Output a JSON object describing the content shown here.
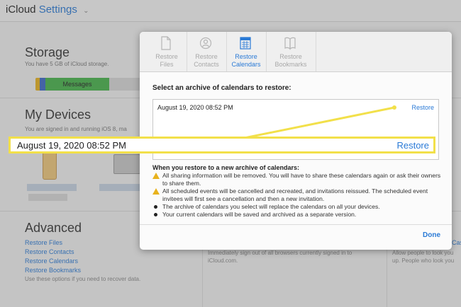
{
  "header": {
    "brand_a": "iCloud",
    "brand_b": "Settings",
    "chevron": "⌄"
  },
  "storage": {
    "title": "Storage",
    "subtitle": "You have 5 GB of iCloud storage.",
    "bar_label": "Messages"
  },
  "devices": {
    "title": "My Devices",
    "subtitle": "You are signed in and running iOS 8, ma"
  },
  "advanced": {
    "title": "Advanced",
    "links": [
      "Restore Files",
      "Restore Contacts",
      "Restore Calendars",
      "Restore Bookmarks"
    ],
    "note": "Use these options if you need to recover data."
  },
  "bg_columns": {
    "middle": [
      "Immediately sign out of all browsers currently signed in to",
      "iCloud.com."
    ],
    "right": [
      "Allow people to look you",
      "up. People who look you"
    ],
    "right_link_fragment": "Cas"
  },
  "modal": {
    "tabs": [
      {
        "l1": "Restore",
        "l2": "Files",
        "icon": "file-icon",
        "active": false
      },
      {
        "l1": "Restore",
        "l2": "Contacts",
        "icon": "contacts-icon",
        "active": false
      },
      {
        "l1": "Restore",
        "l2": "Calendars",
        "icon": "calendar-icon",
        "active": true
      },
      {
        "l1": "Restore",
        "l2": "Bookmarks",
        "icon": "bookmarks-icon",
        "active": false
      }
    ],
    "heading": "Select an archive of calendars to restore:",
    "archive": {
      "date": "August 19, 2020 08:52 PM",
      "action": "Restore"
    },
    "info_title": "When you restore to a new archive of calendars:",
    "info_items": [
      {
        "icon": "warning-icon",
        "text": "All sharing information will be removed. You will have to share these calendars again or ask their owners to share them."
      },
      {
        "icon": "warning-icon",
        "text": "All scheduled events will be cancelled and recreated, and invitations reissued. The scheduled event invitees will first see a cancellation and then a new invitation."
      },
      {
        "icon": "bullet-icon",
        "text": "The archive of calendars you select will replace the calendars on all your devices."
      },
      {
        "icon": "bullet-icon",
        "text": "Your current calendars will be saved and archived as a separate version."
      }
    ],
    "done": "Done"
  },
  "callout": {
    "date": "August 19, 2020 08:52 PM",
    "action": "Restore"
  },
  "colors": {
    "accent": "#2a7ad6",
    "highlight": "#f2e04a",
    "storage_green": "#45b44a"
  }
}
